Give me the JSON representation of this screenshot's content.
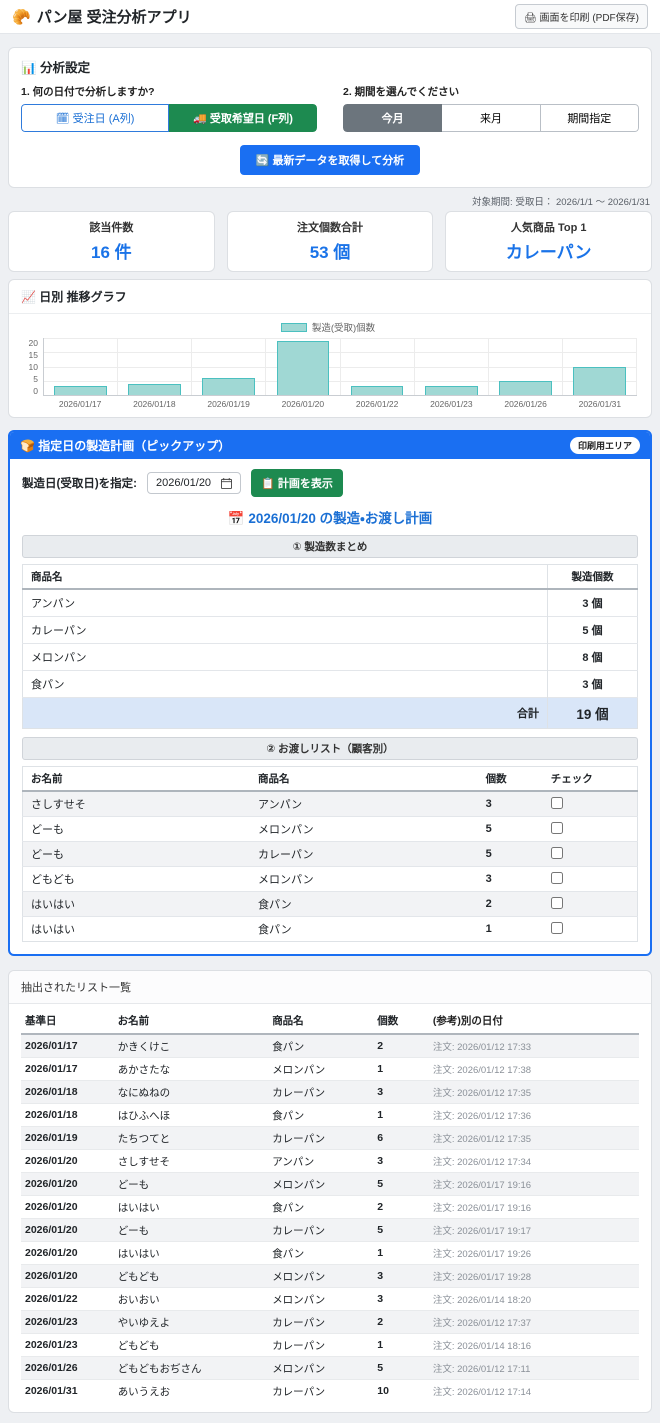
{
  "header": {
    "app_icon": "🥐",
    "app_title": "パン屋 受注分析アプリ",
    "print_button": {
      "icon": "🖨",
      "label": "画面を印刷 (PDF保存)"
    }
  },
  "analysis": {
    "title_icon": "📊",
    "title": "分析設定",
    "q1_label": "1. 何の日付で分析しますか?",
    "date_buttons": [
      {
        "icon": "🗓",
        "label": "受注日 (A列)",
        "active": false
      },
      {
        "icon": "🚚",
        "label": "受取希望日 (F列)",
        "active": true
      }
    ],
    "q2_label": "2. 期間を選んでください",
    "period_buttons": [
      {
        "label": "今月",
        "active": true
      },
      {
        "label": "来月",
        "active": false
      },
      {
        "label": "期間指定",
        "active": false
      }
    ],
    "analyze_button": {
      "icon": "🔄",
      "label": "最新データを取得して分析"
    }
  },
  "target_period": "対象期間: 受取日： 2026/1/1 ～ 2026/1/31",
  "summary_cards": [
    {
      "label": "該当件数",
      "value": "16 件"
    },
    {
      "label": "注文個数合計",
      "value": "53 個"
    },
    {
      "label": "人気商品 Top 1",
      "value": "カレーパン"
    }
  ],
  "chart_section": {
    "title_icon": "📈",
    "title": "日別 推移グラフ"
  },
  "chart_data": {
    "type": "bar",
    "title": "日別 推移グラフ",
    "legend": "製造(受取)個数",
    "legend_position": "top",
    "categories": [
      "2026/01/17",
      "2026/01/18",
      "2026/01/19",
      "2026/01/20",
      "2026/01/22",
      "2026/01/23",
      "2026/01/26",
      "2026/01/31"
    ],
    "values": [
      3,
      4,
      6,
      19,
      3,
      3,
      5,
      10
    ],
    "xlabel": "",
    "ylabel": "",
    "ylim": [
      0,
      20
    ],
    "yticks": [
      0,
      5,
      10,
      15,
      20
    ],
    "grid": true,
    "bar_color": "#a0d8d4",
    "bar_border": "#4bc0c0"
  },
  "plan_section": {
    "title_icon": "🍞",
    "title": "指定日の製造計画（ピックアップ）",
    "print_area_badge": "印刷用エリア",
    "date_label": "製造日(受取日)を指定:",
    "date_value": "2026/01/20",
    "show_plan_button": {
      "icon": "📋",
      "label": "計画を表示"
    },
    "plan_title": {
      "icon": "📅",
      "text": "2026/01/20 の製造・お渡し計画"
    },
    "summary_header": "① 製造数まとめ",
    "summary_table": {
      "col_product": "商品名",
      "col_qty": "製造個数",
      "rows": [
        {
          "product": "アンパン",
          "qty": "3 個"
        },
        {
          "product": "カレーパン",
          "qty": "5 個"
        },
        {
          "product": "メロンパン",
          "qty": "8 個"
        },
        {
          "product": "食パン",
          "qty": "3 個"
        }
      ],
      "total_label": "合計",
      "total_qty": "19 個"
    },
    "handover_header": "② お渡しリスト（顧客別）",
    "handover_table": {
      "col_name": "お名前",
      "col_product": "商品名",
      "col_qty": "個数",
      "col_check": "チェック",
      "rows": [
        {
          "name": "さしすせそ",
          "product": "アンパン",
          "qty": "3",
          "checked": false
        },
        {
          "name": "どーも",
          "product": "メロンパン",
          "qty": "5",
          "checked": false
        },
        {
          "name": "どーも",
          "product": "カレーパン",
          "qty": "5",
          "checked": false
        },
        {
          "name": "どもども",
          "product": "メロンパン",
          "qty": "3",
          "checked": false
        },
        {
          "name": "はいはい",
          "product": "食パン",
          "qty": "2",
          "checked": false
        },
        {
          "name": "はいはい",
          "product": "食パン",
          "qty": "1",
          "checked": false
        }
      ]
    }
  },
  "extracted_section": {
    "title": "抽出されたリスト一覧",
    "columns": [
      "基準日",
      "お名前",
      "商品名",
      "個数",
      "(参考)別の日付"
    ],
    "rows": [
      [
        "2026/01/17",
        "かきくけこ",
        "食パン",
        "2",
        "注文: 2026/01/12 17:33"
      ],
      [
        "2026/01/17",
        "あかさたな",
        "メロンパン",
        "1",
        "注文: 2026/01/12 17:38"
      ],
      [
        "2026/01/18",
        "なにぬねの",
        "カレーパン",
        "3",
        "注文: 2026/01/12 17:35"
      ],
      [
        "2026/01/18",
        "はひふへほ",
        "食パン",
        "1",
        "注文: 2026/01/12 17:36"
      ],
      [
        "2026/01/19",
        "たちつてと",
        "カレーパン",
        "6",
        "注文: 2026/01/12 17:35"
      ],
      [
        "2026/01/20",
        "さしすせそ",
        "アンパン",
        "3",
        "注文: 2026/01/12 17:34"
      ],
      [
        "2026/01/20",
        "どーも",
        "メロンパン",
        "5",
        "注文: 2026/01/17 19:16"
      ],
      [
        "2026/01/20",
        "はいはい",
        "食パン",
        "2",
        "注文: 2026/01/17 19:16"
      ],
      [
        "2026/01/20",
        "どーも",
        "カレーパン",
        "5",
        "注文: 2026/01/17 19:17"
      ],
      [
        "2026/01/20",
        "はいはい",
        "食パン",
        "1",
        "注文: 2026/01/17 19:26"
      ],
      [
        "2026/01/20",
        "どもども",
        "メロンパン",
        "3",
        "注文: 2026/01/17 19:28"
      ],
      [
        "2026/01/22",
        "おいおい",
        "メロンパン",
        "3",
        "注文: 2026/01/14 18:20"
      ],
      [
        "2026/01/23",
        "やいゆえよ",
        "カレーパン",
        "2",
        "注文: 2026/01/12 17:37"
      ],
      [
        "2026/01/23",
        "どもども",
        "カレーパン",
        "1",
        "注文: 2026/01/14 18:16"
      ],
      [
        "2026/01/26",
        "どもどもおぢさん",
        "メロンパン",
        "5",
        "注文: 2026/01/12 17:11"
      ],
      [
        "2026/01/31",
        "あいうえお",
        "カレーパン",
        "10",
        "注文: 2026/01/12 17:14"
      ]
    ]
  },
  "colors": {
    "accent_blue": "#1a6ff2",
    "value_blue": "#1a73e8",
    "accent_green": "#1d8a50",
    "accent_gray": "#6c757d",
    "bar_teal": "#a0d8d4",
    "total_row_bg": "#d9e6f8"
  }
}
